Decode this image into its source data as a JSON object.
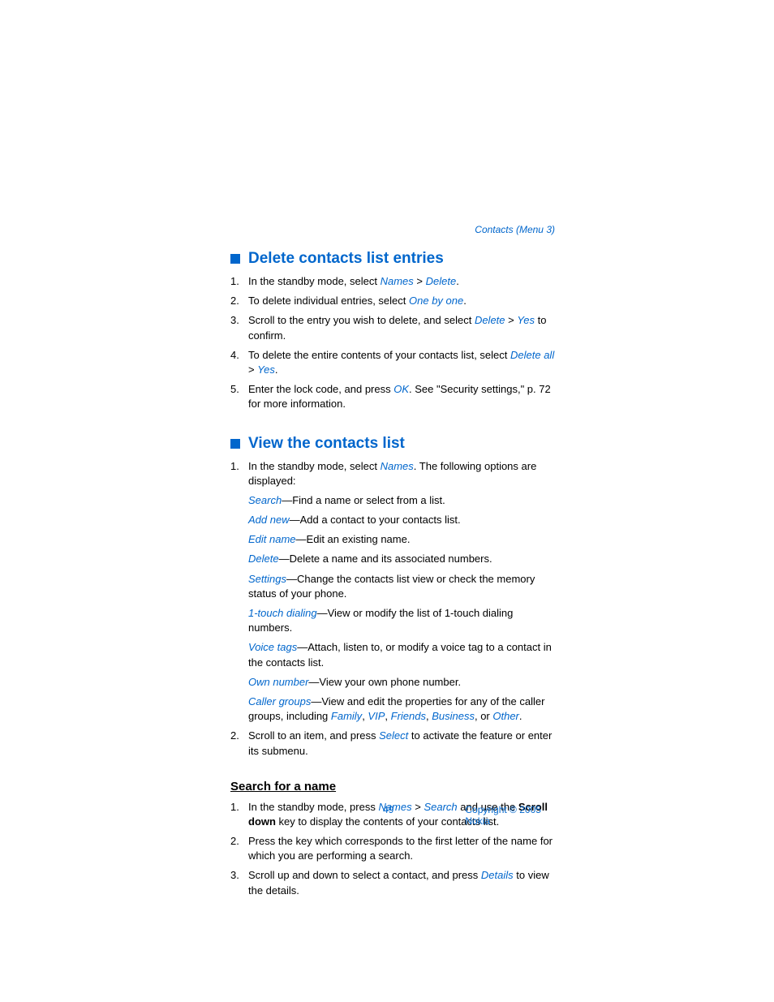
{
  "header": "Contacts (Menu 3)",
  "section1": {
    "title": "Delete contacts list entries",
    "steps": [
      {
        "pre": "In the standby mode, select ",
        "em1": "Names ",
        "mid1": " > ",
        "em2": "Delete",
        "post": "."
      },
      {
        "pre": "To delete individual entries, select ",
        "em1": "One by one",
        "post": "."
      },
      {
        "pre": "Scroll to the entry you wish to delete, and select ",
        "em1": "Delete",
        "mid1": " > ",
        "em2": "Yes",
        "post": " to confirm."
      },
      {
        "pre": "To delete the entire contents of your contacts list, select ",
        "em1": "Delete all",
        "mid1": " > ",
        "em2": "Yes",
        "post": "."
      },
      {
        "pre": "Enter the lock code, and press ",
        "em1": "OK",
        "post": ". See \"Security settings,\" p. 72 for more information."
      }
    ]
  },
  "section2": {
    "title": "View the contacts list",
    "step1": {
      "pre": "In the standby mode, select ",
      "em1": "Names",
      "post": ". The following options are displayed:"
    },
    "defs": [
      {
        "term": "Search",
        "desc": "—Find a name or select from a list."
      },
      {
        "term": "Add new",
        "desc": "—Add a contact to your contacts list."
      },
      {
        "term": "Edit name",
        "desc": "—Edit an existing name."
      },
      {
        "term": "Delete",
        "desc": "—Delete a name and its associated numbers."
      },
      {
        "term": "Settings",
        "desc": "—Change the contacts list view or check the memory status of your phone."
      },
      {
        "term": "1-touch dialing",
        "desc": "—View or modify the list of 1-touch dialing numbers."
      },
      {
        "term": "Voice tags",
        "desc": "—Attach, listen to, or modify a voice tag to a contact in the contacts list."
      },
      {
        "term": "Own number",
        "desc": "—View your own phone number."
      }
    ],
    "callerGroups": {
      "term": "Caller groups",
      "desc1": "—View and edit the properties for any of the caller groups, including ",
      "g1": "Family",
      "s1": ", ",
      "g2": "VIP",
      "s2": ", ",
      "g3": "Friends",
      "s3": ", ",
      "g4": "Business",
      "s4": ", or ",
      "g5": "Other",
      "s5": "."
    },
    "step2": {
      "pre": "Scroll to an item, and press ",
      "em1": "Select",
      "post": " to activate the feature or enter its submenu."
    }
  },
  "section3": {
    "title": "Search for a name",
    "steps": [
      {
        "pre": "In the standby mode, press ",
        "em1": "Names",
        "mid1": " > ",
        "em2": "Search",
        "mid2": " and use the ",
        "bold": "Scroll down",
        "post": " key to display the contents of your contacts list."
      },
      {
        "pre": "Press the key which corresponds to the first letter of the name for which you are performing a search."
      },
      {
        "pre": "Scroll up and down to select a contact, and press ",
        "em1": "Details",
        "post": " to view the details."
      }
    ]
  },
  "footer": {
    "page": "49",
    "copyright": "Copyright © 2005 Nokia"
  }
}
